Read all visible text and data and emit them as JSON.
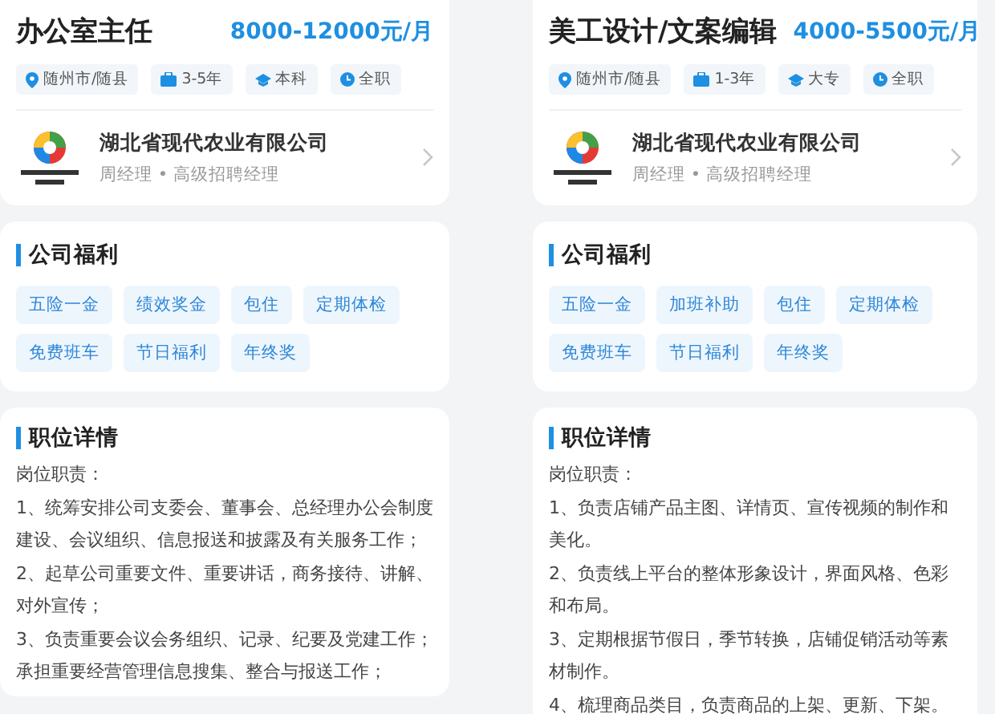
{
  "jobs": [
    {
      "title": "办公室主任",
      "salary": "8000-12000元/月",
      "tags": [
        {
          "kind": "location",
          "text": "随州市/随县"
        },
        {
          "kind": "experience",
          "text": "3-5年"
        },
        {
          "kind": "education",
          "text": "本科"
        },
        {
          "kind": "type",
          "text": "全职"
        }
      ],
      "company": {
        "name": "湖北省现代农业有限公司",
        "contact": "周经理 • 高级招聘经理"
      },
      "welfare_title": "公司福利",
      "welfare": [
        "五险一金",
        "绩效奖金",
        "包住",
        "定期体检",
        "免费班车",
        "节日福利",
        "年终奖"
      ],
      "details_title": "职位详情",
      "details": [
        "岗位职责：",
        "1、统筹安排公司支委会、董事会、总经理办公会制度建设、会议组织、信息报送和披露及有关服务工作；",
        "2、起草公司重要文件、重要讲话，商务接待、讲解、对外宣传；",
        "3、负责重要会议会务组织、记录、纪要及党建工作；承担重要经营管理信息搜集、整合与报送工作；"
      ]
    },
    {
      "title": "美工设计/文案编辑",
      "salary": "4000-5500元/月",
      "tags": [
        {
          "kind": "location",
          "text": "随州市/随县"
        },
        {
          "kind": "experience",
          "text": "1-3年"
        },
        {
          "kind": "education",
          "text": "大专"
        },
        {
          "kind": "type",
          "text": "全职"
        }
      ],
      "company": {
        "name": "湖北省现代农业有限公司",
        "contact": "周经理 • 高级招聘经理"
      },
      "welfare_title": "公司福利",
      "welfare": [
        "五险一金",
        "加班补助",
        "包住",
        "定期体检",
        "免费班车",
        "节日福利",
        "年终奖"
      ],
      "details_title": "职位详情",
      "details": [
        "岗位职责：",
        "1、负责店铺产品主图、详情页、宣传视频的制作和美化。",
        "2、负责线上平台的整体形象设计，界面风格、色彩和布局。",
        "3、定期根据节假日，季节转换，店铺促销活动等素材制作。",
        "4、梳理商品类目，负责商品的上架、更新、下架。"
      ]
    }
  ]
}
